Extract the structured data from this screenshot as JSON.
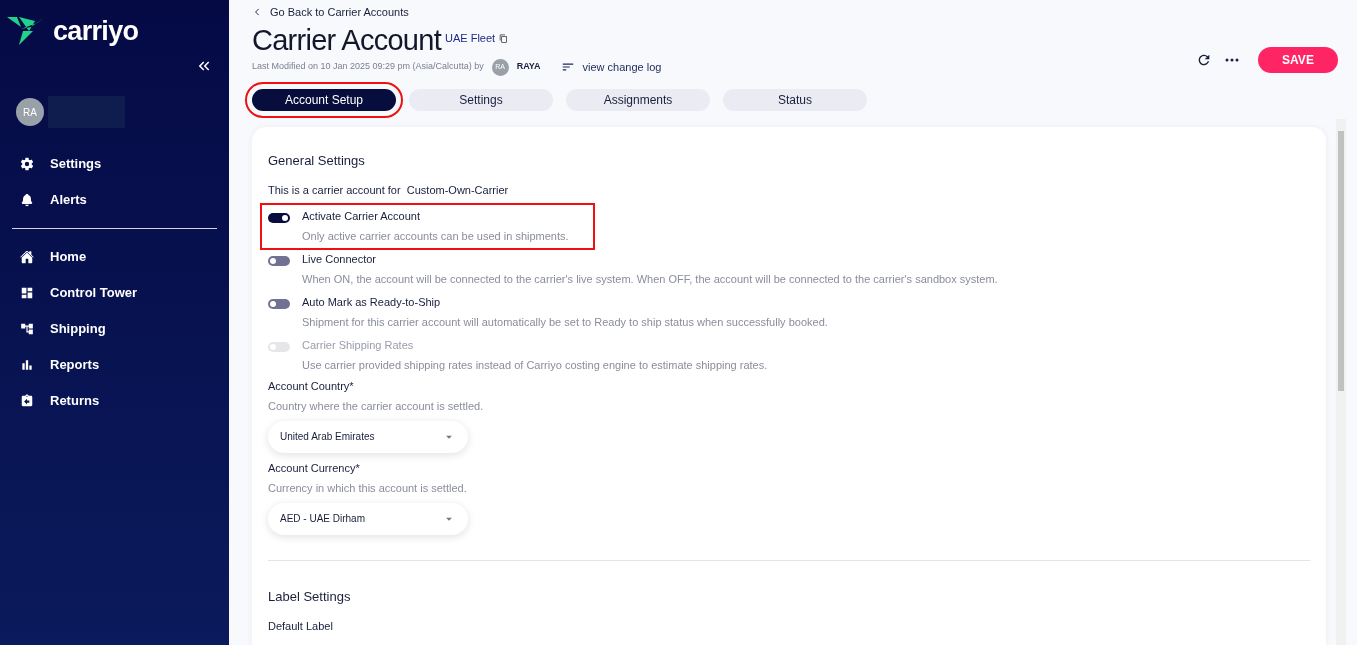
{
  "sidebar": {
    "brand": "carriyo",
    "user": {
      "initials": "RA"
    },
    "items": [
      {
        "label": "Settings"
      },
      {
        "label": "Alerts"
      },
      {
        "label": "Home"
      },
      {
        "label": "Control Tower"
      },
      {
        "label": "Shipping"
      },
      {
        "label": "Reports"
      },
      {
        "label": "Returns"
      }
    ]
  },
  "header": {
    "back_link": "Go Back to Carrier Accounts",
    "title": "Carrier Account",
    "subtitle": "UAE Fleet",
    "modified": "Last Modified on 10 Jan 2025 09:29 pm (Asia/Calcutta) by",
    "user_initials": "RA",
    "user": "RAYA",
    "change_log": "view change log",
    "save": "SAVE"
  },
  "tabs": [
    {
      "label": "Account Setup",
      "selected": true,
      "highlighted": true
    },
    {
      "label": "Settings",
      "selected": false,
      "highlighted": false
    },
    {
      "label": "Assignments",
      "selected": false,
      "highlighted": false
    },
    {
      "label": "Status",
      "selected": false,
      "highlighted": false
    }
  ],
  "general": {
    "heading": "General Settings",
    "intro": "This is a carrier account for  Custom-Own-Carrier",
    "toggles": [
      {
        "label": "Activate Carrier Account",
        "description": "Only active carrier accounts can be used in shipments.",
        "on": true,
        "disabled": false,
        "highlighted": true
      },
      {
        "label": "Live Connector",
        "description": "When ON, the account will be connected to the carrier's live system. When OFF, the account will be connected to the carrier's sandbox system.",
        "on": false,
        "disabled": false,
        "highlighted": false
      },
      {
        "label": "Auto Mark as Ready-to-Ship",
        "description": "Shipment for this carrier account will automatically be set to Ready to ship status when successfully booked.",
        "on": false,
        "disabled": false,
        "highlighted": false
      },
      {
        "label": "Carrier Shipping Rates",
        "description": "Use carrier provided shipping rates instead of Carriyo costing engine to estimate shipping rates.",
        "on": false,
        "disabled": true,
        "highlighted": false
      }
    ],
    "selects": [
      {
        "label": "Account Country*",
        "hint": "Country where the carrier account is settled.",
        "value": "United Arab Emirates"
      },
      {
        "label": "Account Currency*",
        "hint": "Currency in which this account is settled.",
        "value": "AED - UAE Dirham"
      }
    ]
  },
  "label_settings": {
    "heading": "Label Settings",
    "field": "Default Label"
  }
}
